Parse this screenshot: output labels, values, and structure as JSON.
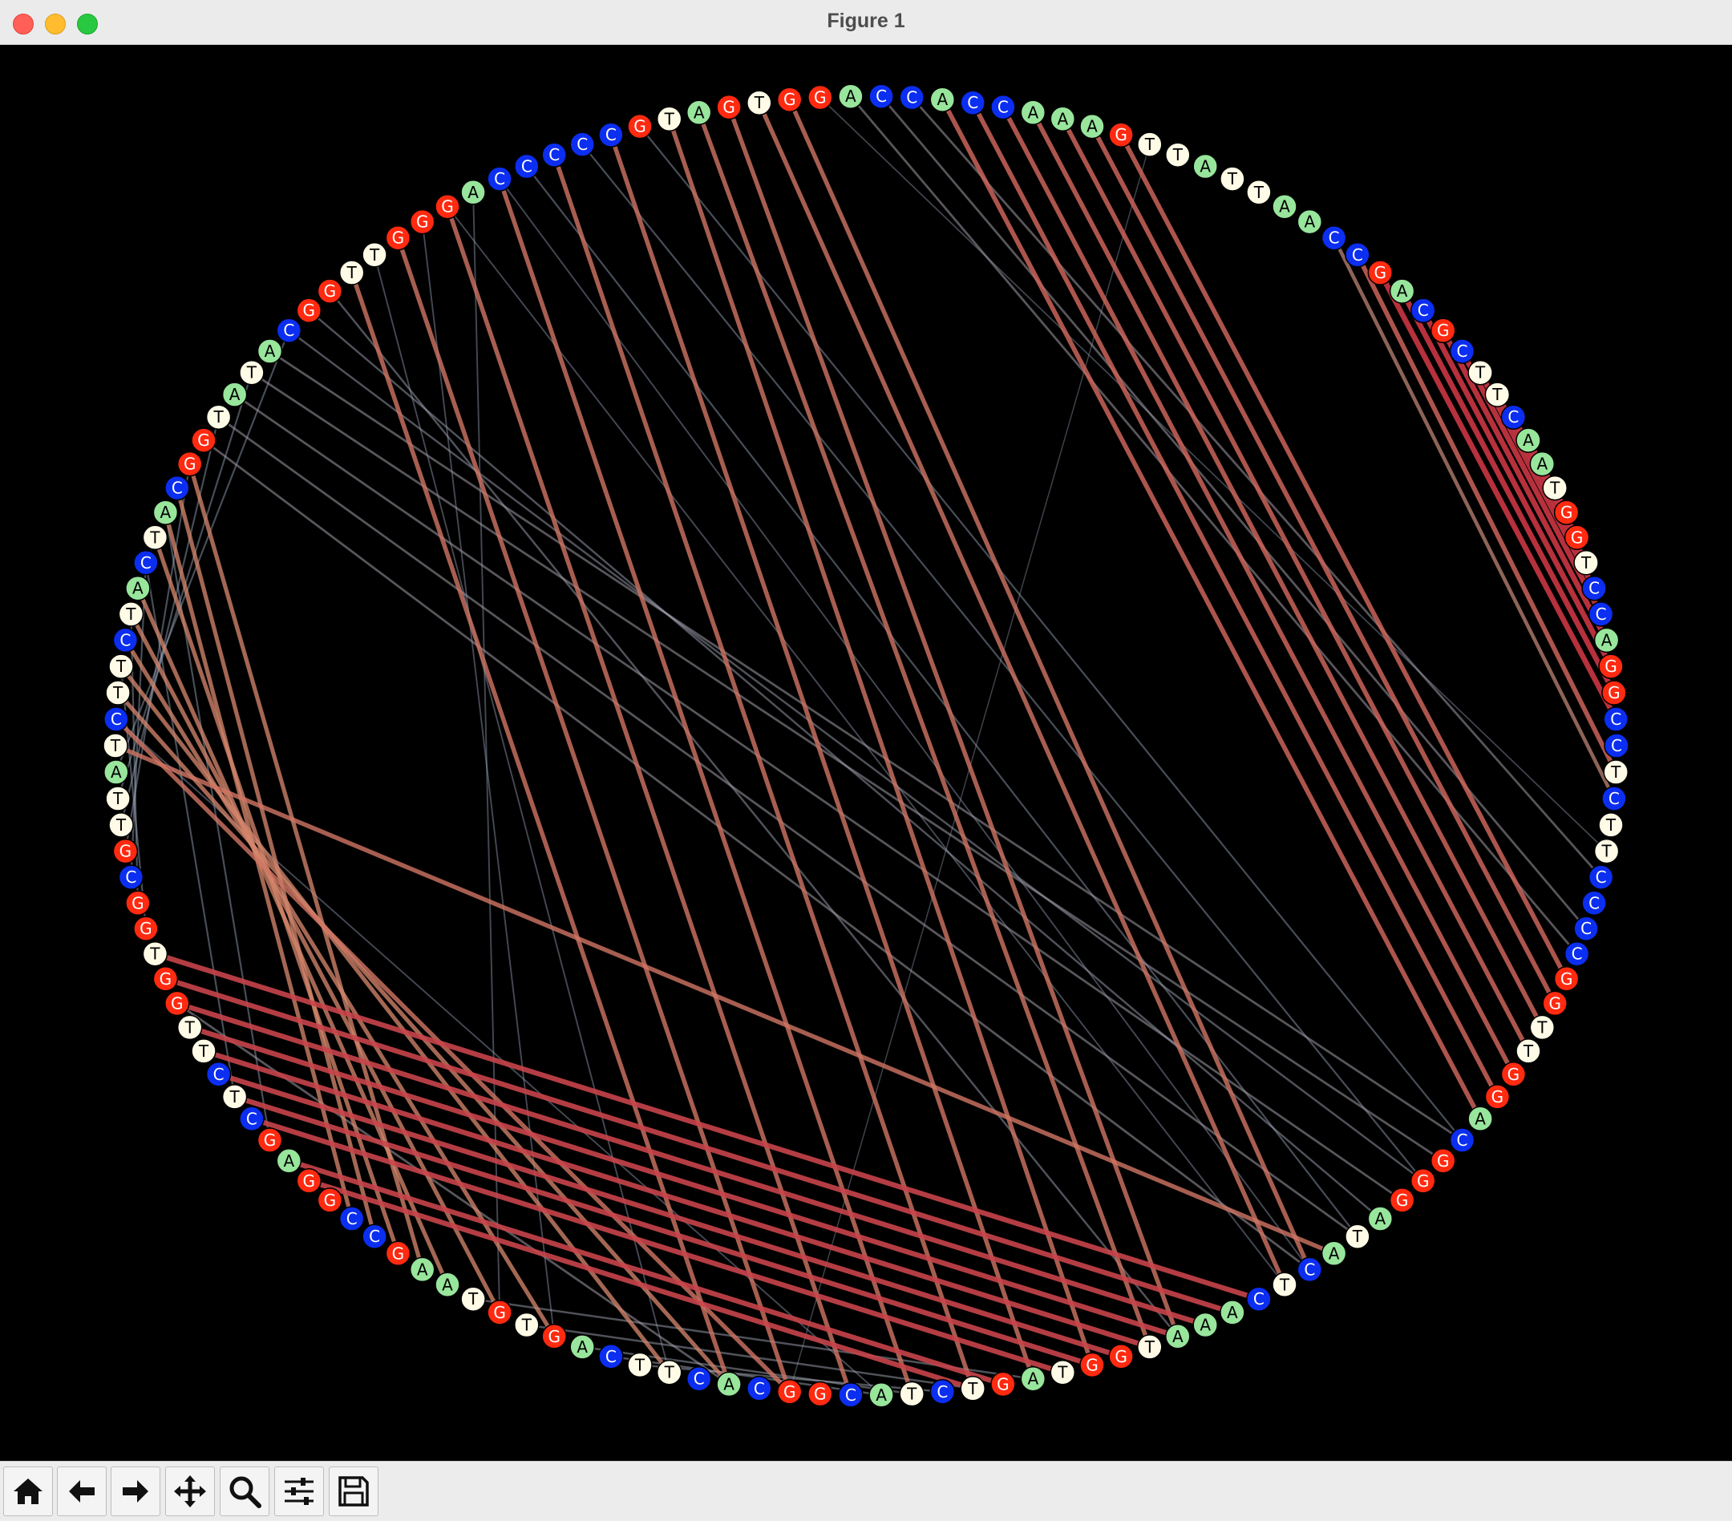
{
  "window": {
    "title": "Figure 1"
  },
  "toolbar": {
    "buttons": [
      {
        "name": "home-button",
        "icon": "home-icon"
      },
      {
        "name": "back-button",
        "icon": "arrow-left-icon"
      },
      {
        "name": "forward-button",
        "icon": "arrow-right-icon"
      },
      {
        "name": "pan-button",
        "icon": "move-icon"
      },
      {
        "name": "zoom-button",
        "icon": "magnifier-icon"
      },
      {
        "name": "configure-subplots-button",
        "icon": "sliders-icon"
      },
      {
        "name": "save-button",
        "icon": "floppy-disk-icon"
      }
    ]
  },
  "colors": {
    "A": "#98e59c",
    "C": "#0b2ef0",
    "G": "#ff2a10",
    "T": "#fffbe6",
    "strong_pair": "#c4253a",
    "pair": "#d4866c",
    "weak_pair": "#9aa6bc",
    "background": "#000000"
  },
  "chart_data": {
    "type": "circular-arc-diagram",
    "sequence": "TCTTCTACTACGGTATACGGTTGGGACCCCCGTAGTGGACCACCAAAGTTATTAACCGACGCTTCAATGGTCCAGGCCTCTTCCCCGGTTGGACGGGATACTCAAATGGTAGTCTACGGCACTTCAGTGTAAGCCGGAGCTCTTGGTGGCGTTA",
    "links": [
      {
        "i": 20,
        "j": 120,
        "s": 0.75
      },
      {
        "i": 22,
        "j": 118,
        "s": 0.75
      },
      {
        "i": 24,
        "j": 116,
        "s": 0.75
      },
      {
        "i": 26,
        "j": 114,
        "s": 0.75
      },
      {
        "i": 28,
        "j": 112,
        "s": 0.75
      },
      {
        "i": 30,
        "j": 110,
        "s": 0.75
      },
      {
        "i": 33,
        "j": 106,
        "s": 0.75
      },
      {
        "i": 32,
        "j": 108,
        "s": 0.75
      },
      {
        "i": 34,
        "j": 105,
        "s": 0.75
      },
      {
        "i": 35,
        "j": 101,
        "s": 0.75
      },
      {
        "i": 36,
        "j": 100,
        "s": 0.75
      },
      {
        "i": 41,
        "j": 92,
        "s": 0.8
      },
      {
        "i": 42,
        "j": 91,
        "s": 0.8
      },
      {
        "i": 43,
        "j": 90,
        "s": 0.8
      },
      {
        "i": 44,
        "j": 89,
        "s": 0.8
      },
      {
        "i": 45,
        "j": 88,
        "s": 0.8
      },
      {
        "i": 46,
        "j": 87,
        "s": 0.8
      },
      {
        "i": 47,
        "j": 86,
        "s": 0.8
      },
      {
        "i": 57,
        "j": 76,
        "s": 0.95
      },
      {
        "i": 58,
        "j": 75,
        "s": 0.95
      },
      {
        "i": 59,
        "j": 74,
        "s": 0.95
      },
      {
        "i": 60,
        "j": 73,
        "s": 0.95
      },
      {
        "i": 61,
        "j": 72,
        "s": 0.95
      },
      {
        "i": 62,
        "j": 71,
        "s": 0.95
      },
      {
        "i": 63,
        "j": 70,
        "s": 0.95
      },
      {
        "i": 64,
        "j": 69,
        "s": 0.95
      },
      {
        "i": 65,
        "j": 68,
        "s": 0.95
      },
      {
        "i": 56,
        "j": 78,
        "s": 0.8
      },
      {
        "i": 55,
        "j": 79,
        "s": 0.6
      },
      {
        "i": 102,
        "j": 146,
        "s": 0.9
      },
      {
        "i": 103,
        "j": 145,
        "s": 0.9
      },
      {
        "i": 104,
        "j": 144,
        "s": 0.9
      },
      {
        "i": 105,
        "j": 143,
        "s": 0.9
      },
      {
        "i": 106,
        "j": 142,
        "s": 0.9
      },
      {
        "i": 107,
        "j": 141,
        "s": 0.9
      },
      {
        "i": 108,
        "j": 140,
        "s": 0.9
      },
      {
        "i": 109,
        "j": 139,
        "s": 0.9
      },
      {
        "i": 111,
        "j": 137,
        "s": 0.9
      },
      {
        "i": 112,
        "j": 136,
        "s": 0.9
      },
      {
        "i": 99,
        "j": 0,
        "s": 0.75
      },
      {
        "i": 118,
        "j": 1,
        "s": 0.75
      },
      {
        "i": 2,
        "j": 120,
        "s": 0.7
      },
      {
        "i": 3,
        "j": 122,
        "s": 0.7
      },
      {
        "i": 4,
        "j": 126,
        "s": 0.7
      },
      {
        "i": 5,
        "j": 128,
        "s": 0.7
      },
      {
        "i": 6,
        "j": 130,
        "s": 0.7
      },
      {
        "i": 8,
        "j": 132,
        "s": 0.7
      },
      {
        "i": 9,
        "j": 134,
        "s": 0.7
      },
      {
        "i": 10,
        "j": 133,
        "s": 0.7
      },
      {
        "i": 11,
        "j": 131,
        "s": 0.7
      },
      {
        "i": 39,
        "j": 84,
        "s": 0.3
      },
      {
        "i": 40,
        "j": 82,
        "s": 0.3
      },
      {
        "i": 38,
        "j": 85,
        "s": 0.3
      },
      {
        "i": 124,
        "j": 115,
        "s": 0.25
      },
      {
        "i": 125,
        "j": 114,
        "s": 0.25
      },
      {
        "i": 123,
        "j": 113,
        "s": 0.25
      },
      {
        "i": 127,
        "j": 112,
        "s": 0.25
      },
      {
        "i": 129,
        "j": 110,
        "s": 0.25
      },
      {
        "i": 144,
        "j": 120,
        "s": 0.3
      },
      {
        "i": 12,
        "j": 100,
        "s": 0.3
      },
      {
        "i": 13,
        "j": 98,
        "s": 0.3
      },
      {
        "i": 14,
        "j": 96,
        "s": 0.3
      },
      {
        "i": 15,
        "j": 94,
        "s": 0.3
      },
      {
        "i": 16,
        "j": 93,
        "s": 0.3
      },
      {
        "i": 17,
        "j": 95,
        "s": 0.25
      },
      {
        "i": 18,
        "j": 97,
        "s": 0.25
      },
      {
        "i": 19,
        "j": 105,
        "s": 0.25
      },
      {
        "i": 27,
        "j": 98,
        "s": 0.2
      },
      {
        "i": 29,
        "j": 95,
        "s": 0.2
      },
      {
        "i": 31,
        "j": 93,
        "s": 0.2
      },
      {
        "i": 100,
        "j": 26,
        "s": 0.15
      },
      {
        "i": 101,
        "j": 24,
        "s": 0.15
      },
      {
        "i": 1,
        "j": 115,
        "s": 0.15
      },
      {
        "i": 21,
        "j": 122,
        "s": 0.15
      },
      {
        "i": 23,
        "j": 126,
        "s": 0.15
      },
      {
        "i": 25,
        "j": 128,
        "s": 0.15
      },
      {
        "i": 7,
        "j": 140,
        "s": 0.2
      },
      {
        "i": 138,
        "j": 9,
        "s": 0.2
      },
      {
        "i": 147,
        "j": 3,
        "s": 0.2
      },
      {
        "i": 148,
        "j": 5,
        "s": 0.2
      },
      {
        "i": 149,
        "j": 7,
        "s": 0.2
      },
      {
        "i": 150,
        "j": 11,
        "s": 0.2
      },
      {
        "i": 151,
        "j": 13,
        "s": 0.2
      },
      {
        "i": 152,
        "j": 15,
        "s": 0.2
      },
      {
        "i": 153,
        "j": 17,
        "s": 0.2
      },
      {
        "i": 154,
        "j": 19,
        "s": 0.2
      },
      {
        "i": 37,
        "j": 81,
        "s": 0.12
      },
      {
        "i": 48,
        "j": 118,
        "s": 0.08
      }
    ]
  }
}
